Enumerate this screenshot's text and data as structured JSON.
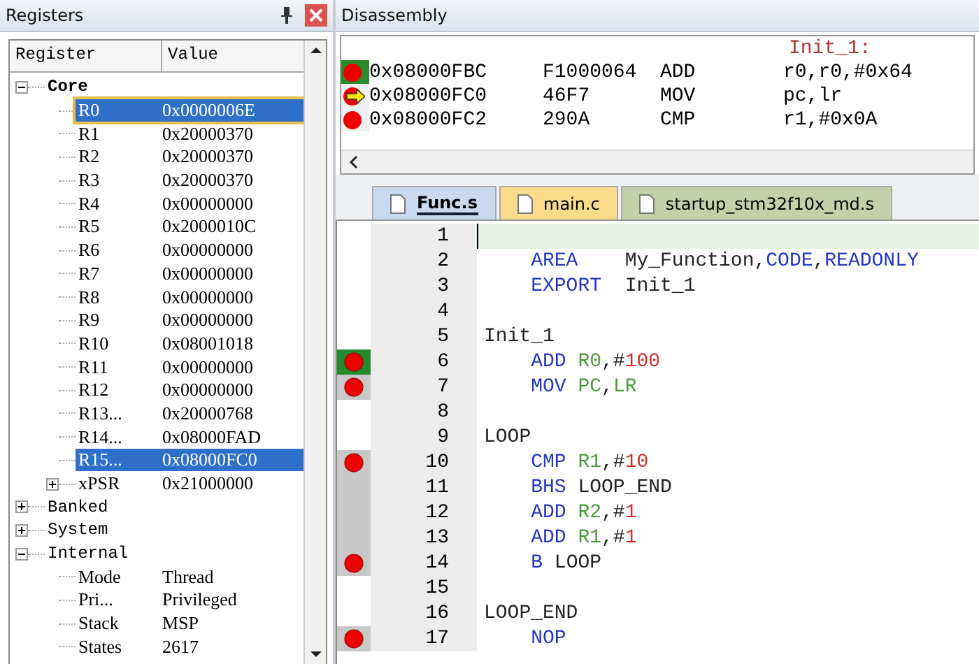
{
  "registers": {
    "title": "Registers",
    "columns": [
      "Register",
      "Value"
    ],
    "tree": [
      {
        "name": "Core",
        "expanded": true,
        "selected": false,
        "focused": false,
        "children": [
          {
            "name": "R0",
            "value": "0x0000006E",
            "selected": true,
            "focused": true
          },
          {
            "name": "R1",
            "value": "0x20000370",
            "selected": false,
            "focused": false
          },
          {
            "name": "R2",
            "value": "0x20000370",
            "selected": false,
            "focused": false
          },
          {
            "name": "R3",
            "value": "0x20000370",
            "selected": false,
            "focused": false
          },
          {
            "name": "R4",
            "value": "0x00000000",
            "selected": false,
            "focused": false
          },
          {
            "name": "R5",
            "value": "0x2000010C",
            "selected": false,
            "focused": false
          },
          {
            "name": "R6",
            "value": "0x00000000",
            "selected": false,
            "focused": false
          },
          {
            "name": "R7",
            "value": "0x00000000",
            "selected": false,
            "focused": false
          },
          {
            "name": "R8",
            "value": "0x00000000",
            "selected": false,
            "focused": false
          },
          {
            "name": "R9",
            "value": "0x00000000",
            "selected": false,
            "focused": false
          },
          {
            "name": "R10",
            "value": "0x08001018",
            "selected": false,
            "focused": false
          },
          {
            "name": "R11",
            "value": "0x00000000",
            "selected": false,
            "focused": false
          },
          {
            "name": "R12",
            "value": "0x00000000",
            "selected": false,
            "focused": false
          },
          {
            "name": "R13...",
            "value": "0x20000768",
            "selected": false,
            "focused": false
          },
          {
            "name": "R14...",
            "value": "0x08000FAD",
            "selected": false,
            "focused": false
          },
          {
            "name": "R15...",
            "value": "0x08000FC0",
            "selected": true,
            "focused": false
          },
          {
            "name": "xPSR",
            "value": "0x21000000",
            "expanded": false,
            "selected": false,
            "focused": false
          }
        ]
      },
      {
        "name": "Banked",
        "expanded": false,
        "selected": false,
        "focused": false
      },
      {
        "name": "System",
        "expanded": false,
        "selected": false,
        "focused": false
      },
      {
        "name": "Internal",
        "expanded": true,
        "selected": false,
        "focused": false,
        "children": [
          {
            "name": "Mode",
            "value": "Thread",
            "selected": false,
            "focused": false
          },
          {
            "name": "Pri...",
            "value": "Privileged",
            "selected": false,
            "focused": false
          },
          {
            "name": "Stack",
            "value": "MSP",
            "selected": false,
            "focused": false
          },
          {
            "name": "States",
            "value": "2617",
            "selected": false,
            "focused": false
          }
        ]
      }
    ]
  },
  "disassembly": {
    "title": "Disassembly",
    "label": "Init_1:",
    "lines": [
      {
        "address": "0x08000FBC",
        "opcode": "F1000064",
        "mnemonic": "ADD",
        "operands": "r0,r0,#0x64",
        "breakpoint": true,
        "executed": true,
        "current": false
      },
      {
        "address": "0x08000FC0",
        "opcode": "46F7",
        "mnemonic": "MOV",
        "operands": "pc,lr",
        "breakpoint": true,
        "executed": false,
        "current": true
      },
      {
        "address": "0x08000FC2",
        "opcode": "290A",
        "mnemonic": "CMP",
        "operands": "r1,#0x0A",
        "breakpoint": true,
        "executed": false,
        "current": false
      }
    ]
  },
  "tabs": [
    {
      "label": "Func.s",
      "selected": true,
      "color": "#c9d9f0"
    },
    {
      "label": "main.c",
      "selected": false,
      "color": "#f8dc8a"
    },
    {
      "label": "startup_stm32f10x_md.s",
      "selected": false,
      "color": "#c4d0a8"
    }
  ],
  "editor": {
    "lines": [
      {
        "number": "1",
        "breakpoint": false,
        "executed": false,
        "current": false,
        "cursor": true
      },
      {
        "number": "2",
        "breakpoint": false,
        "executed": false,
        "current": false,
        "cursor": false,
        "tokens": [
          {
            "text": "    AREA",
            "kind": "keyword"
          },
          {
            "text": "    My_Function,",
            "kind": "plain"
          },
          {
            "text": "CODE",
            "kind": "keyword"
          },
          {
            "text": ",",
            "kind": "plain"
          },
          {
            "text": "READONLY",
            "kind": "keyword"
          }
        ]
      },
      {
        "number": "3",
        "breakpoint": false,
        "executed": false,
        "current": false,
        "cursor": false,
        "tokens": [
          {
            "text": "    EXPORT",
            "kind": "keyword"
          },
          {
            "text": "  Init_1",
            "kind": "plain"
          }
        ]
      },
      {
        "number": "4",
        "breakpoint": false,
        "executed": false,
        "current": false,
        "cursor": false
      },
      {
        "number": "5",
        "breakpoint": false,
        "executed": false,
        "current": false,
        "cursor": false,
        "tokens": [
          {
            "text": "Init_1",
            "kind": "plain"
          }
        ]
      },
      {
        "number": "6",
        "breakpoint": true,
        "executed": true,
        "current": true,
        "cursor": false,
        "tokens": [
          {
            "text": "    ADD ",
            "kind": "keyword"
          },
          {
            "text": "R0",
            "kind": "register"
          },
          {
            "text": ",#",
            "kind": "plain"
          },
          {
            "text": "100",
            "kind": "number"
          }
        ]
      },
      {
        "number": "7",
        "breakpoint": true,
        "executed": true,
        "current": false,
        "cursor": false,
        "tokens": [
          {
            "text": "    MOV ",
            "kind": "keyword"
          },
          {
            "text": "PC",
            "kind": "register"
          },
          {
            "text": ",",
            "kind": "plain"
          },
          {
            "text": "LR",
            "kind": "register"
          }
        ]
      },
      {
        "number": "8",
        "breakpoint": false,
        "executed": false,
        "current": false,
        "cursor": false
      },
      {
        "number": "9",
        "breakpoint": false,
        "executed": false,
        "current": false,
        "cursor": false,
        "tokens": [
          {
            "text": "LOOP",
            "kind": "plain"
          }
        ]
      },
      {
        "number": "10",
        "breakpoint": true,
        "executed": true,
        "current": false,
        "cursor": false,
        "tokens": [
          {
            "text": "    CMP ",
            "kind": "keyword"
          },
          {
            "text": "R1",
            "kind": "register"
          },
          {
            "text": ",#",
            "kind": "plain"
          },
          {
            "text": "10",
            "kind": "number"
          }
        ]
      },
      {
        "number": "11",
        "breakpoint": false,
        "executed": true,
        "current": false,
        "cursor": false,
        "tokens": [
          {
            "text": "    BHS ",
            "kind": "keyword"
          },
          {
            "text": "LOOP_END",
            "kind": "plain"
          }
        ]
      },
      {
        "number": "12",
        "breakpoint": false,
        "executed": true,
        "current": false,
        "cursor": false,
        "tokens": [
          {
            "text": "    ADD ",
            "kind": "keyword"
          },
          {
            "text": "R2",
            "kind": "register"
          },
          {
            "text": ",#",
            "kind": "plain"
          },
          {
            "text": "1",
            "kind": "number"
          }
        ]
      },
      {
        "number": "13",
        "breakpoint": false,
        "executed": true,
        "current": false,
        "cursor": false,
        "tokens": [
          {
            "text": "    ADD ",
            "kind": "keyword"
          },
          {
            "text": "R1",
            "kind": "register"
          },
          {
            "text": ",#",
            "kind": "plain"
          },
          {
            "text": "1",
            "kind": "number"
          }
        ]
      },
      {
        "number": "14",
        "breakpoint": true,
        "executed": true,
        "current": false,
        "cursor": false,
        "tokens": [
          {
            "text": "    B ",
            "kind": "keyword"
          },
          {
            "text": "LOOP",
            "kind": "plain"
          }
        ]
      },
      {
        "number": "15",
        "breakpoint": false,
        "executed": false,
        "current": false,
        "cursor": false
      },
      {
        "number": "16",
        "breakpoint": false,
        "executed": false,
        "current": false,
        "cursor": false,
        "tokens": [
          {
            "text": "LOOP_END",
            "kind": "plain"
          }
        ]
      },
      {
        "number": "17",
        "breakpoint": true,
        "executed": true,
        "current": false,
        "cursor": false,
        "tokens": [
          {
            "text": "    NOP",
            "kind": "keyword"
          }
        ]
      }
    ]
  }
}
